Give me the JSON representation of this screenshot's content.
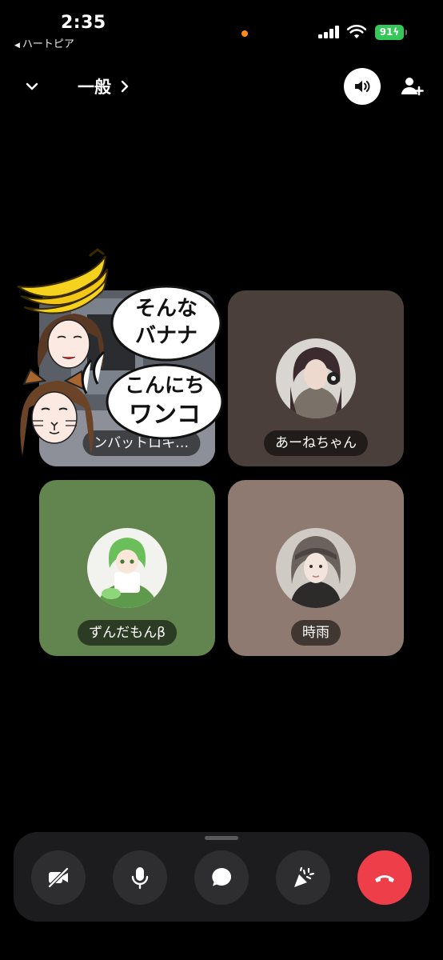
{
  "status": {
    "time": "2:35",
    "back_app": "ハートピア",
    "battery": "91"
  },
  "header": {
    "channel_name": "一般"
  },
  "participants": [
    {
      "name": "ンバットロキ…"
    },
    {
      "name": "あーねちゃん"
    },
    {
      "name": "ずんだもんβ"
    },
    {
      "name": "時雨"
    }
  ],
  "stickers": {
    "bubble_1_line1": "そんな",
    "bubble_1_line2": "バナナ",
    "bubble_2_line1": "こんにち",
    "bubble_2_line2": "ワンコ"
  },
  "colors": {
    "end_call": "#ee3e4a",
    "battery": "#35c759",
    "recording_dot": "#ff8a1e"
  }
}
